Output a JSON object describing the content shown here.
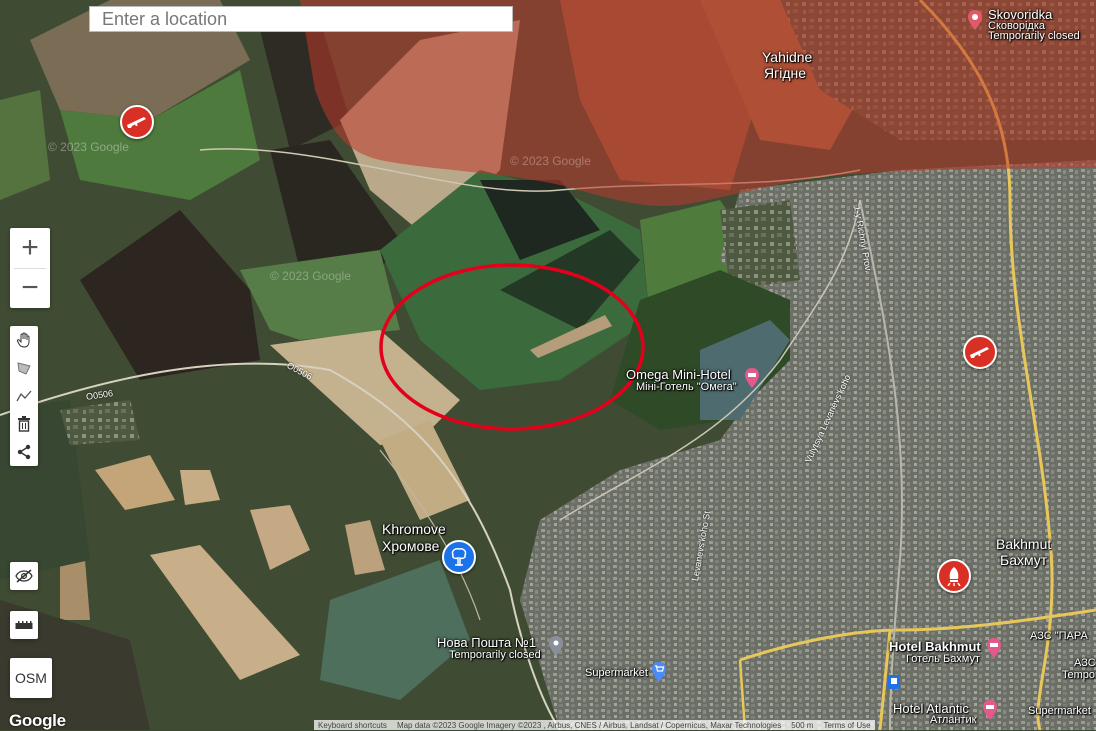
{
  "search": {
    "placeholder": "Enter a location"
  },
  "controls": {
    "zoom_in": "+",
    "zoom_out": "−",
    "tools": [
      "hand-icon",
      "polygon-icon",
      "polyline-icon",
      "trash-icon",
      "share-icon"
    ],
    "hide_icon": "eye-slash-icon",
    "ruler_icon": "ruler-icon",
    "osm_label": "OSM"
  },
  "places": {
    "skovoridka": {
      "name": "Skovoridka",
      "local": "Сковорідка",
      "status": "Temporarily closed"
    },
    "yahidne": {
      "name": "Yahidne",
      "local": "Ягідне"
    },
    "omega": {
      "name": "Omega Mini-Hotel",
      "local": "Міні-Готель \"Омега\""
    },
    "khromove": {
      "name": "Khromove",
      "local": "Хромове"
    },
    "bakhmut": {
      "name": "Bakhmut",
      "local": "Бахмут"
    },
    "nova_poshta": {
      "name": "Нова Пошта №1",
      "status": "Temporarily closed"
    },
    "supermarket1": {
      "name": "Supermarket"
    },
    "supermarket2": {
      "name": "Supermarket"
    },
    "hotel_bakhmut": {
      "name": "Hotel Bakhmut",
      "local": "Готель Бахмут"
    },
    "hotel_atlantic": {
      "name": "Hotel Atlantic",
      "local": "Атлантик"
    },
    "azs": {
      "name": "АЗС \"ПАРА",
      "local": "АЗС",
      "status": "Tempor"
    }
  },
  "roads": {
    "o0506_a": "O0506",
    "o0506_b": "O0506",
    "levanevs1": "Levanevs'koho St",
    "levanevs2": "Vulytsya Levanevs'koho",
    "richnyi": "1-y Richnyi Prov."
  },
  "watermark": "© 2023 Google",
  "attribution": {
    "shortcuts": "Keyboard shortcuts",
    "data": "Map data ©2023 Google Imagery ©2023 , Airbus, CNES / Airbus, Landsat / Copernicus, Maxar Technologies",
    "scale": "500 m",
    "terms": "Terms of Use"
  },
  "google_logo": "Google",
  "colors": {
    "occupied_overlay": "#c0392b",
    "highlight_circle": "#e3001b",
    "pin_red": "#d93025",
    "pin_blue": "#1a73e8",
    "road_yellow": "#e8c75a"
  },
  "markers": [
    {
      "name": "rifle-marker",
      "icon": "rifle-icon"
    },
    {
      "name": "rifle-marker",
      "icon": "rifle-icon"
    },
    {
      "name": "bomb-marker",
      "icon": "bomb-icon"
    },
    {
      "name": "explosion-marker",
      "icon": "explosion-icon"
    }
  ]
}
